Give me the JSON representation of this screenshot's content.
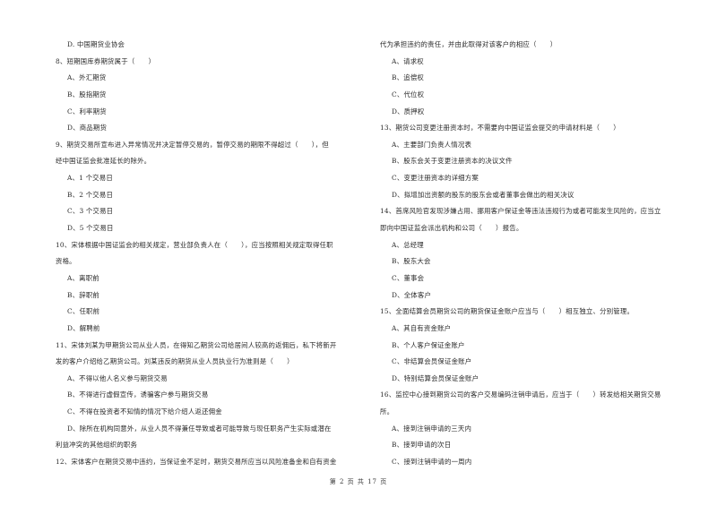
{
  "left_column": [
    {
      "type": "option",
      "text": "D. 中国期货业协会"
    },
    {
      "type": "question",
      "text": "8、短期国库券期货属于（　　）"
    },
    {
      "type": "option",
      "text": "A、外汇期货"
    },
    {
      "type": "option",
      "text": "B、股指期货"
    },
    {
      "type": "option",
      "text": "C、利率期货"
    },
    {
      "type": "option",
      "text": "D、商品期货"
    },
    {
      "type": "question",
      "text": "9、期货交易所宣布进入异常情况并决定暂停交易的，暂停交易的期限不得超过（　　），但"
    },
    {
      "type": "question",
      "text": "经中国证监会批准延长的除外。"
    },
    {
      "type": "option",
      "text": "A、1 个交易日"
    },
    {
      "type": "option",
      "text": "B、2 个交易日"
    },
    {
      "type": "option",
      "text": "C、3 个交易日"
    },
    {
      "type": "option",
      "text": "D、5 个交易日"
    },
    {
      "type": "question",
      "text": "10、宋体根据中国证监会的相关规定，营业部负责人在（　　），应当按照相关规定取得任职"
    },
    {
      "type": "question",
      "text": "资格。"
    },
    {
      "type": "option",
      "text": "A、离职前"
    },
    {
      "type": "option",
      "text": "B、辞职前"
    },
    {
      "type": "option",
      "text": "C、任职前"
    },
    {
      "type": "option",
      "text": "D、解聘前"
    },
    {
      "type": "question",
      "text": "11、宋体刘某为甲期货公司从业人员，在得知乙期货公司给居间人较高的返佣后，私下将新开"
    },
    {
      "type": "question",
      "text": "发的客户介绍给乙期货公司。刘某违反的期货从业人员执业行为准则是（　　）"
    },
    {
      "type": "option",
      "text": "A、不得以他人名义参与期货交易"
    },
    {
      "type": "option",
      "text": "B、不得进行虚假宣传，诱骗客户参与期货交易"
    },
    {
      "type": "option",
      "text": "C、不得在投资者不知情的情况下给介绍人返还佣金"
    },
    {
      "type": "option",
      "text": "D、除所在机构同意外，从业人员不得兼任导致或者可能导致与现任职务产生实际或潜在"
    },
    {
      "type": "question",
      "text": "利益冲突的其他组织的职务"
    },
    {
      "type": "question",
      "text": "12、宋体客户在期货交易中违约，当保证金不足时，期货交易所应当以风险准备金和自有资金"
    }
  ],
  "right_column": [
    {
      "type": "question",
      "text": "代为承担违约的责任，并由此取得对该客户的相应（　　）"
    },
    {
      "type": "option",
      "text": "A、请求权"
    },
    {
      "type": "option",
      "text": "B、追偿权"
    },
    {
      "type": "option",
      "text": "C、代位权"
    },
    {
      "type": "option",
      "text": "D、质押权"
    },
    {
      "type": "question",
      "text": "13、期货公司变更注册资本时，不需要向中国证监会提交的申请材料是（　　）"
    },
    {
      "type": "option",
      "text": "A、主要部门负责人情况表"
    },
    {
      "type": "option",
      "text": "B、股东会关于变更注册资本的决议文件"
    },
    {
      "type": "option",
      "text": "C、变更注册资本的详细方案"
    },
    {
      "type": "option",
      "text": "D、拟增加出资额的股东的股东会或者董事会做出的相关决议"
    },
    {
      "type": "question",
      "text": "14、首席风险官发现涉嫌占用、挪用客户保证金等违法违规行为或者可能发生风险的，应当立"
    },
    {
      "type": "question",
      "text": "即向中国证监会派出机构和公司（　　）报告。"
    },
    {
      "type": "option",
      "text": "A、总经理"
    },
    {
      "type": "option",
      "text": "B、股东大会"
    },
    {
      "type": "option",
      "text": "C、董事会"
    },
    {
      "type": "option",
      "text": "D、全体客户"
    },
    {
      "type": "question",
      "text": "15、全面结算会员期货公司的期货保证金账户应当与（　　）相互独立、分别管理。"
    },
    {
      "type": "option",
      "text": "A、其自有资金账户"
    },
    {
      "type": "option",
      "text": "B、个人客户保证金账户"
    },
    {
      "type": "option",
      "text": "C、非结算会员保证金账户"
    },
    {
      "type": "option",
      "text": "D、特别结算会员保证金账户"
    },
    {
      "type": "question",
      "text": "16、监控中心接到期货公司的客户交易编码注销申请后，应当于（　　）转发给相关期货交易"
    },
    {
      "type": "question",
      "text": "所。"
    },
    {
      "type": "option",
      "text": "A、接到注销申请的三天内"
    },
    {
      "type": "option",
      "text": "B、接到申请的次日"
    },
    {
      "type": "option",
      "text": "C、接到注销申请的一周内"
    }
  ],
  "footer": {
    "page_label": "第 2 页 共 17 页"
  }
}
